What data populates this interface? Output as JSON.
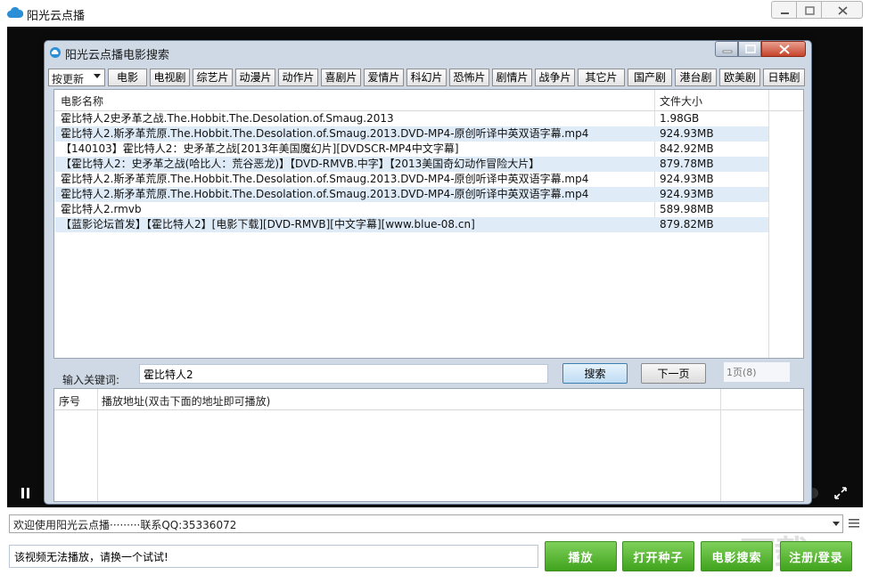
{
  "window": {
    "title": "阳光云点播"
  },
  "dialog": {
    "title": "阳光云点播电影搜索"
  },
  "toolbar": {
    "sort_value": "按更新",
    "categories": [
      "电影",
      "电视剧",
      "综艺片",
      "动漫片",
      "动作片",
      "喜剧片",
      "爱情片",
      "科幻片",
      "恐怖片",
      "剧情片",
      "战争片",
      "其它片",
      "国产剧",
      "港台剧",
      "欧美剧",
      "日韩剧"
    ]
  },
  "results": {
    "headers": {
      "name": "电影名称",
      "size": "文件大小"
    },
    "rows": [
      {
        "name": "霍比特人2史矛革之战.The.Hobbit.The.Desolation.of.Smaug.2013",
        "size": "1.98GB"
      },
      {
        "name": "霍比特人2.斯矛革荒原.The.Hobbit.The.Desolation.of.Smaug.2013.DVD-MP4-原创听译中英双语字幕.mp4",
        "size": "924.93MB"
      },
      {
        "name": "【140103】霍比特人2：史矛革之战[2013年美国魔幻片][DVDSCR-MP4中文字幕]",
        "size": "842.92MB"
      },
      {
        "name": "【霍比特人2：史矛革之战(哈比人：荒谷恶龙)】【DVD-RMVB.中字】【2013美国奇幻动作冒险大片】",
        "size": "879.78MB"
      },
      {
        "name": "霍比特人2.斯矛革荒原.The.Hobbit.The.Desolation.of.Smaug.2013.DVD-MP4-原创听译中英双语字幕.mp4",
        "size": "924.93MB"
      },
      {
        "name": "霍比特人2.斯矛革荒原.The.Hobbit.The.Desolation.of.Smaug.2013.DVD-MP4-原创听译中英双语字幕.mp4",
        "size": "924.93MB"
      },
      {
        "name": "霍比特人2.rmvb",
        "size": "589.98MB"
      },
      {
        "name": "【蓝影论坛首发】【霍比特人2】[电影下载][DVD-RMVB][中文字幕][www.blue-08.cn]",
        "size": "879.82MB"
      }
    ]
  },
  "search": {
    "label": "输入关键词:",
    "value": "霍比特人2",
    "search_btn": "搜索",
    "next_btn": "下一页",
    "page_info": "1页(8)"
  },
  "play_list": {
    "headers": {
      "index": "序号",
      "address": "播放地址(双击下面的地址即可播放)"
    }
  },
  "bottom": {
    "notice": "欢迎使用阳光云点播·········联系QQ:35336072",
    "status": "该视频无法播放，请换一个试试!",
    "buttons": [
      "播放",
      "打开种子",
      "电影搜索",
      "注册/登录"
    ]
  },
  "watermark": "下载",
  "colors": {
    "accent_green": "#4fb52a",
    "row_highlight": "#dfecf8",
    "dialog_bg": "#cfd9e6"
  }
}
